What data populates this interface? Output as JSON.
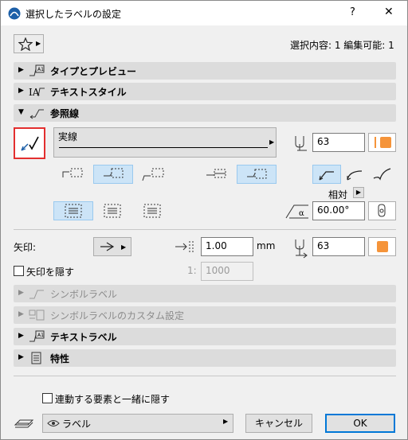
{
  "window": {
    "title": "選択したラベルの設定",
    "help": "?",
    "close": "✕"
  },
  "header": {
    "selection_info": "選択内容: 1 編集可能: 1"
  },
  "sections": {
    "type_preview": "タイプとプレビュー",
    "text_style": "テキストスタイル",
    "leader": "参照線",
    "symbol_label": "シンボルラベル",
    "symbol_label_custom": "シンボルラベルのカスタム設定",
    "text_label": "テキストラベル",
    "properties": "特性"
  },
  "leader": {
    "line_type": "実線",
    "pen_value": "63",
    "relative_label": "相対",
    "angle_value": "60.00°"
  },
  "arrow": {
    "label": "矢印:",
    "size_value": "1.00",
    "size_unit": "mm",
    "pen_value": "63",
    "hide_label": "矢印を隠す",
    "scale_prefix": "1:",
    "scale_value": "1000"
  },
  "footer": {
    "hide_with_linked": "連動する要素と一緒に隠す",
    "layer_value": "ラベル",
    "cancel_label": "キャンセル",
    "ok_label": "OK"
  },
  "colors": {
    "accent": "#e32f2f",
    "pen_orange": "#f5943a",
    "selected_bg": "#cce4f7",
    "section_bg": "#dcdcdc"
  }
}
